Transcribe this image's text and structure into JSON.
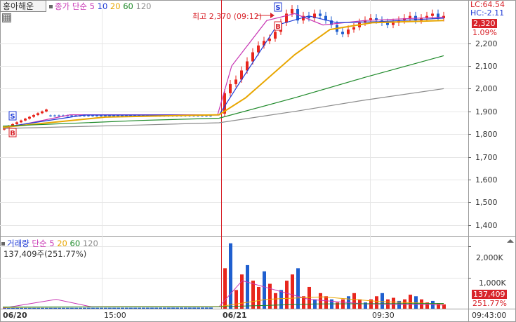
{
  "header": {
    "stock_name": "홍아해운",
    "indicator": "종가 단순",
    "ma_periods": [
      "5",
      "10",
      "20",
      "60",
      "120"
    ],
    "ma_colors": [
      "#c837b4",
      "#1f3bd6",
      "#e8a600",
      "#1f8a2a",
      "#8c8c8c"
    ]
  },
  "right_panel": {
    "lc": "LC:64.54",
    "hc": "HC:-2.11",
    "price_badge": "2,320",
    "pct_badge": "1.09%"
  },
  "max_annotation": "최고 2,370 (09:12)",
  "signals": {
    "sell": "S",
    "buy": "B"
  },
  "price_axis": [
    "2,200",
    "2,100",
    "2,000",
    "1,900",
    "1,800",
    "1,700",
    "1,600",
    "1,500",
    "1,400"
  ],
  "volume_panel": {
    "title": "거래량",
    "indicator": "단순",
    "ma_periods": [
      "5",
      "20",
      "60",
      "120"
    ],
    "ma_colors": [
      "#c837b4",
      "#e8a600",
      "#1f8a2a",
      "#8c8c8c"
    ],
    "summary": "137,409주(251.77%)",
    "axis": [
      "2,000K",
      "1,000K"
    ],
    "vol_badge": "137,409",
    "vol_pct_badge": "251.77%"
  },
  "time_axis": {
    "labels": [
      "06/20",
      "15:00",
      "06/21",
      "09:30",
      "09:43:00"
    ]
  },
  "colors": {
    "up": "#e8261d",
    "down": "#1f5fcf",
    "divider": "#d8232a"
  },
  "chart_data": {
    "type": "candlestick",
    "price_ylim": [
      1350,
      2390
    ],
    "price_ticks": [
      2200,
      2100,
      2000,
      1900,
      1800,
      1700,
      1600,
      1500,
      1400
    ],
    "high_label": "최고 2,370 (09:12)",
    "last_price": 2320,
    "moving_averages": [
      5,
      10,
      20,
      60,
      120
    ],
    "volume_ylim": [
      0,
      2300000
    ],
    "volume_ticks": [
      2000000,
      1000000
    ],
    "last_volume": 137409
  }
}
